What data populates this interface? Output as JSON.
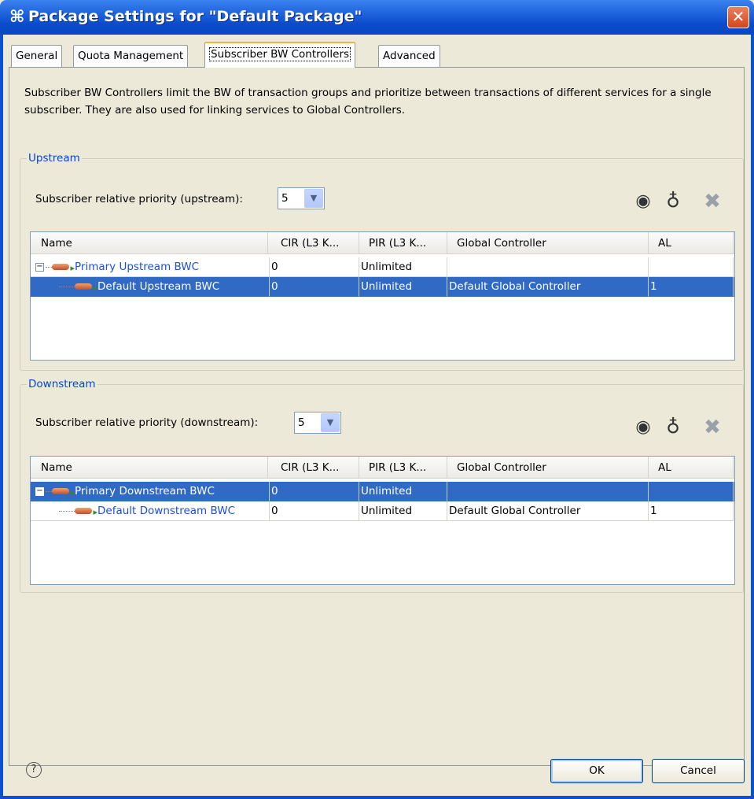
{
  "window": {
    "title": "Package Settings for \"Default Package\"",
    "close_glyph": "✕",
    "icon_glyph": "⌘"
  },
  "tabs": [
    {
      "label": "General",
      "active": false
    },
    {
      "label": "Quota Management",
      "active": false
    },
    {
      "label": "Subscriber BW Controllers",
      "active": true
    },
    {
      "label": "Advanced",
      "active": false
    }
  ],
  "description": "Subscriber BW Controllers limit the BW of transaction groups and prioritize between transactions of different services for a single subscriber. They are also used for linking services to Global Controllers.",
  "upstream": {
    "group_label": "Upstream",
    "priority_label": "Subscriber relative priority (upstream):",
    "priority_value": "5",
    "columns": [
      "Name",
      "CIR (L3 K...",
      "PIR (L3 K...",
      "Global Controller",
      "AL"
    ],
    "rows": [
      {
        "name": "Primary Upstream BWC",
        "cir": "0",
        "pir": "Unlimited",
        "global_controller": "",
        "al": "",
        "expander": "−",
        "selected": false
      },
      {
        "name": "Default Upstream BWC",
        "cir": "0",
        "pir": "Unlimited",
        "global_controller": "Default Global Controller",
        "al": "1",
        "selected": true
      }
    ]
  },
  "downstream": {
    "group_label": "Downstream",
    "priority_label": "Subscriber relative priority (downstream):",
    "priority_value": "5",
    "columns": [
      "Name",
      "CIR (L3 K...",
      "PIR (L3 K...",
      "Global Controller",
      "AL"
    ],
    "rows": [
      {
        "name": "Primary Downstream BWC",
        "cir": "0",
        "pir": "Unlimited",
        "global_controller": "",
        "al": "",
        "expander": "−",
        "selected": true
      },
      {
        "name": "Default Downstream BWC",
        "cir": "0",
        "pir": "Unlimited",
        "global_controller": "Default Global Controller",
        "al": "1",
        "selected": false
      }
    ]
  },
  "toolbar_icons": {
    "add": "add-icon",
    "add_child": "add-child-icon",
    "remove": "remove-icon"
  },
  "buttons": {
    "help": "?",
    "ok": "OK",
    "cancel": "Cancel"
  },
  "colors": {
    "title_bar": "#0a4bcb",
    "selection": "#316ac5",
    "group_label": "#0046d5",
    "active_tab_accent": "#f3b43a"
  }
}
